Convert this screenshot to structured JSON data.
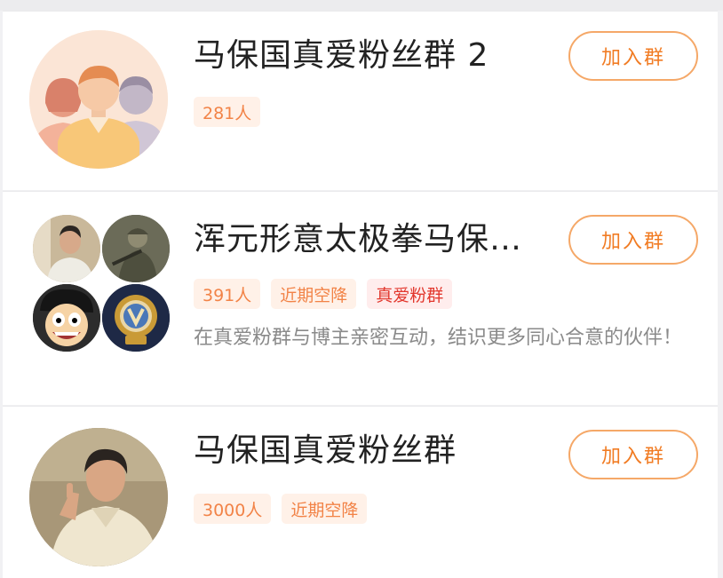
{
  "action_label": "加入群",
  "groups": [
    {
      "name": "马保国真爱粉丝群 2",
      "tags": [
        "281人"
      ]
    },
    {
      "name": "浑元形意太极拳马保…",
      "tags": [
        "391人",
        "近期空降",
        "真爱粉群"
      ],
      "description": "在真爱粉群与博主亲密互动，结识更多同心合意的伙伴！"
    },
    {
      "name": "马保国真爱粉丝群",
      "tags": [
        "3000人",
        "近期空降"
      ]
    }
  ],
  "colors": {
    "accent": "#f17c24",
    "tag_bg": "#fff1e8",
    "tag_red": "#e2382e",
    "text_primary": "#222222",
    "text_secondary": "#8a8a8a"
  }
}
